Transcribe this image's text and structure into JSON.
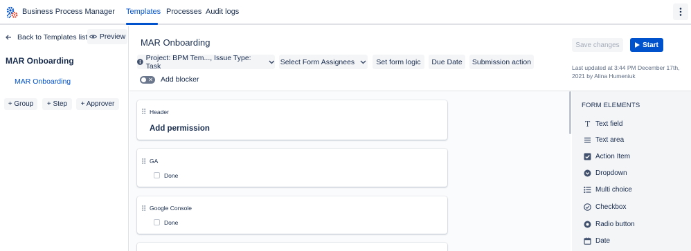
{
  "app": {
    "title": "Business Process Manager",
    "nav": [
      {
        "label": "Templates",
        "active": true
      },
      {
        "label": "Processes",
        "active": false
      },
      {
        "label": "Audit logs",
        "active": false
      }
    ]
  },
  "sidebar": {
    "back_label": "Back to Templates list",
    "preview_label": "Preview",
    "title": "MAR Onboarding",
    "link": "MAR Onboarding",
    "buttons": [
      "+ Group",
      "+ Step",
      "+ Approver"
    ]
  },
  "main": {
    "title": "MAR Onboarding",
    "toolbar": {
      "project": "Project: BPM Tem..., Issue Type: Task",
      "assignees": "Select Form Assignees",
      "logic": "Set form logic",
      "due_date": "Due Date",
      "submission": "Submission action"
    },
    "blocker_label": "Add blocker",
    "save_label": "Save changes",
    "start_label": "Start",
    "updated_text": "Last updated at 3:44 PM December 17th, 2021 by Alina Humeniuk"
  },
  "cards": [
    {
      "label": "Header",
      "heading": "Add permission"
    },
    {
      "label": "GA",
      "checkbox": "Done"
    },
    {
      "label": "Google Console",
      "checkbox": "Done"
    }
  ],
  "form_elements": {
    "title": "FORM ELEMENTS",
    "items": [
      {
        "label": "Text field",
        "icon": "text-field-icon"
      },
      {
        "label": "Text area",
        "icon": "text-area-icon"
      },
      {
        "label": "Action Item",
        "icon": "checked-box-icon"
      },
      {
        "label": "Dropdown",
        "icon": "dropdown-circle-icon"
      },
      {
        "label": "Multi choice",
        "icon": "list-icon"
      },
      {
        "label": "Checkbox",
        "icon": "check-circle-icon"
      },
      {
        "label": "Radio button",
        "icon": "radio-icon"
      },
      {
        "label": "Date",
        "icon": "calendar-icon"
      }
    ]
  },
  "colors": {
    "accent": "#0052cc",
    "text": "#172b4d",
    "muted": "#5e6c84",
    "button_bg": "#f4f5f7"
  }
}
